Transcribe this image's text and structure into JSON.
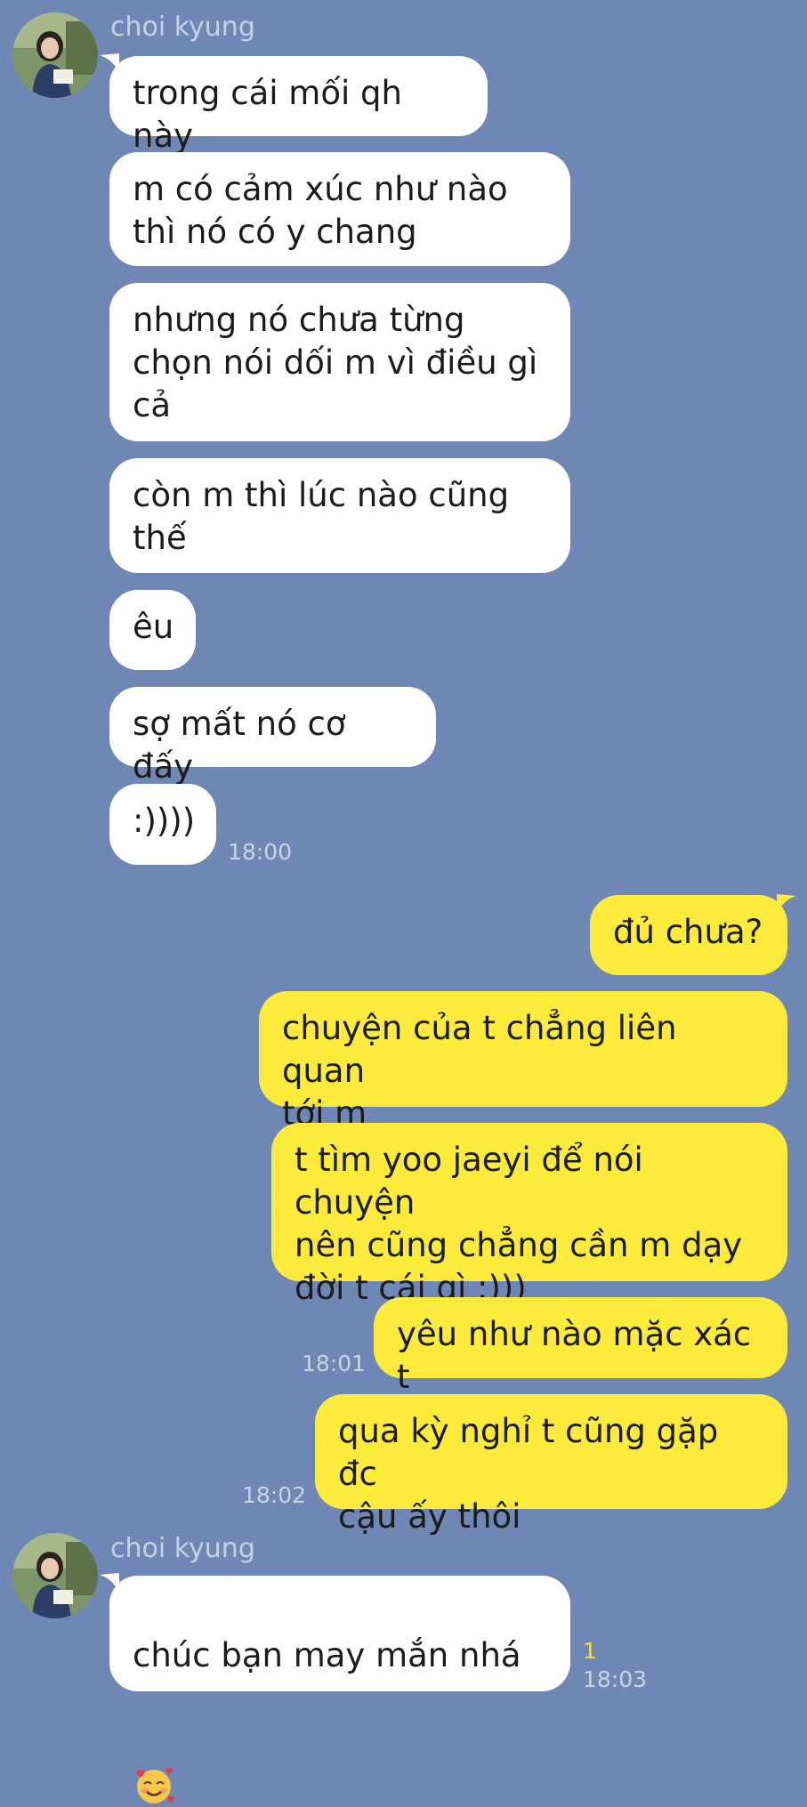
{
  "messages": {
    "sender_name": "choi kyung",
    "m1": "trong cái mối qh này",
    "m2": "m có cảm xúc như nào\nthì nó có y chang",
    "m3": "nhưng nó chưa từng\nchọn nói dối m vì điều gì\ncả",
    "m4": "còn m thì lúc nào cũng\nthế",
    "m5": "êu",
    "m6": "sợ mất nó cơ đấy",
    "m7": ":))))",
    "t1": "18:00",
    "o1": "đủ chưa?",
    "o2": "chuyện của t chẳng liên quan\ntới m",
    "o3": "t tìm yoo jaeyi để nói chuyện\nnên cũng chẳng cần m dạy\nđời t cái gì :)))",
    "o4": "yêu như nào mặc xác t",
    "t2": "18:01",
    "o5": "qua kỳ nghỉ t cũng gặp đc\ncậu ấy thôi",
    "t3": "18:02",
    "m8": "chúc bạn may mắn nhá",
    "m8_emoji": "smiling-face-with-hearts",
    "read_count": "1",
    "t4": "18:03"
  },
  "colors": {
    "background": "#6f87b4",
    "incoming": "#ffffff",
    "outgoing": "#fdeb3c",
    "meta": "#c8d3e6",
    "read_count": "#f4e23b"
  }
}
